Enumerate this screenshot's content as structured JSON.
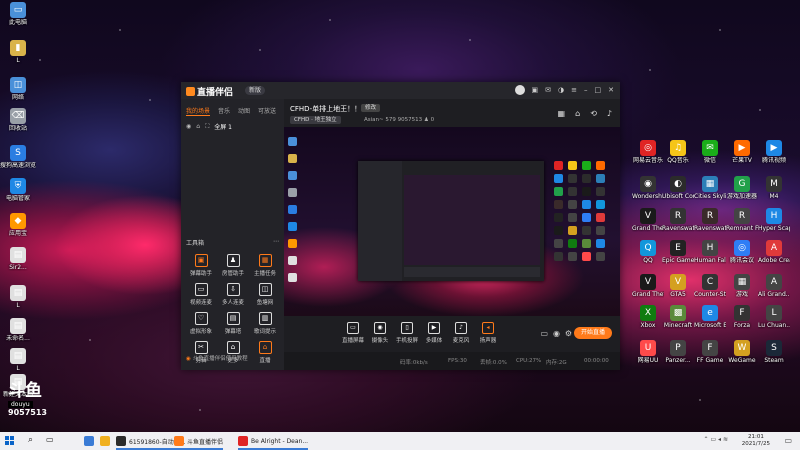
{
  "desktop": {
    "left_icons": [
      {
        "label": "此电脑",
        "color": "#4a90d9",
        "glyph": "▭"
      },
      {
        "label": "L",
        "color": "#d9b34a",
        "glyph": "▮"
      },
      {
        "label": "网络",
        "color": "#4a90d9",
        "glyph": "◫"
      },
      {
        "label": "回收站",
        "color": "#9aa0a8",
        "glyph": "⌫"
      },
      {
        "label": "搜狗高速浏览器",
        "color": "#2a7de1",
        "glyph": "S"
      },
      {
        "label": "电脑管家",
        "color": "#1e88e5",
        "glyph": "⛨"
      },
      {
        "label": "应用宝",
        "color": "#ff9800",
        "glyph": "◆"
      },
      {
        "label": "Sir2...",
        "color": "#e0e0e0",
        "glyph": "▤"
      },
      {
        "label": "L",
        "color": "#e0e0e0",
        "glyph": "▤"
      },
      {
        "label": "未命名...",
        "color": "#e0e0e0",
        "glyph": "▤"
      },
      {
        "label": "L",
        "color": "#e0e0e0",
        "glyph": "▤"
      },
      {
        "label": "新建文本档",
        "color": "#e0e0e0",
        "glyph": "▤"
      }
    ],
    "right_icons": [
      {
        "label": "网易云音乐",
        "color": "#e02424",
        "glyph": "◎"
      },
      {
        "label": "QQ音乐",
        "color": "#f5c518",
        "glyph": "♫"
      },
      {
        "label": "微信",
        "color": "#1aad19",
        "glyph": "✉"
      },
      {
        "label": "芒果TV",
        "color": "#ff6a00",
        "glyph": "▶"
      },
      {
        "label": "腾讯视频",
        "color": "#1e88e5",
        "glyph": "▶"
      },
      {
        "label": "Wondersh... Filmora",
        "color": "#333",
        "glyph": "◉"
      },
      {
        "label": "Ubisoft Connect",
        "color": "#2b2b2b",
        "glyph": "◐"
      },
      {
        "label": "Cities Skylines",
        "color": "#2c7fb8",
        "glyph": "▦"
      },
      {
        "label": "游戏加速器",
        "color": "#21a04a",
        "glyph": "G"
      },
      {
        "label": "M4",
        "color": "#333",
        "glyph": "M"
      },
      {
        "label": "Grand Theft Auto V",
        "color": "#1a1a1a",
        "glyph": "V"
      },
      {
        "label": "Ravenswatch Playtest",
        "color": "#333",
        "glyph": "R"
      },
      {
        "label": "Ravenswatch",
        "color": "#3a2a2a",
        "glyph": "R"
      },
      {
        "label": "Remnant From the...",
        "color": "#444",
        "glyph": "R"
      },
      {
        "label": "Hyper Scape",
        "color": "#1e88e5",
        "glyph": "H"
      },
      {
        "label": "QQ",
        "color": "#1296db",
        "glyph": "Q"
      },
      {
        "label": "Epic Games Launcher",
        "color": "#222",
        "glyph": "E"
      },
      {
        "label": "Human Fall Flat",
        "color": "#444",
        "glyph": "H"
      },
      {
        "label": "腾讯会议",
        "color": "#2e7df6",
        "glyph": "◎"
      },
      {
        "label": "Adobe Creative...",
        "color": "#e03a3a",
        "glyph": "A"
      },
      {
        "label": "Grand Theft Auto V",
        "color": "#1a1a1a",
        "glyph": "V"
      },
      {
        "label": "GTA5",
        "color": "#d4a020",
        "glyph": "V"
      },
      {
        "label": "Counter-Strike",
        "color": "#333",
        "glyph": "C"
      },
      {
        "label": "游戏",
        "color": "#444",
        "glyph": "▦"
      },
      {
        "label": "Ali Grand...",
        "color": "#444",
        "glyph": "A"
      },
      {
        "label": "Xbox",
        "color": "#107c10",
        "glyph": "X"
      },
      {
        "label": "Minecraft",
        "color": "#5a8a3a",
        "glyph": "▩"
      },
      {
        "label": "Microsoft Edge",
        "color": "#1e88e5",
        "glyph": "e"
      },
      {
        "label": "Forza",
        "color": "#333",
        "glyph": "F"
      },
      {
        "label": "Lu Chuan...",
        "color": "#444",
        "glyph": "L"
      },
      {
        "label": "网易UU",
        "color": "#ff4a4a",
        "glyph": "U"
      },
      {
        "label": "Panzer...",
        "color": "#444",
        "glyph": "P"
      },
      {
        "label": "FF Game",
        "color": "#444",
        "glyph": "F"
      },
      {
        "label": "WeGame",
        "color": "#d4a020",
        "glyph": "W"
      },
      {
        "label": "Steam",
        "color": "#1b2838",
        "glyph": "S"
      }
    ],
    "watermark": {
      "brand": "斗鱼",
      "sub": "douyu",
      "room": "9057513"
    }
  },
  "app": {
    "title": "直播伴侣",
    "version_pill": "新版",
    "titlebar_icons": [
      "avatar",
      "message-icon",
      "mail-icon",
      "skin-icon",
      "settings-icon",
      "minimize-icon",
      "maximize-icon",
      "close-icon"
    ],
    "sidebar": {
      "tabs": [
        "我的场景",
        "音乐",
        "动图",
        "可放送"
      ],
      "scene_label": "全屏 1",
      "tools_title": "工具箱",
      "tools": [
        {
          "label": "弹幕助手",
          "glyph": "▣",
          "orange": true
        },
        {
          "label": "房管助手",
          "glyph": "♟",
          "orange": false
        },
        {
          "label": "主播任务",
          "glyph": "▦",
          "orange": true
        },
        {
          "label": "视频连麦",
          "glyph": "▭",
          "orange": false
        },
        {
          "label": "多人连麦",
          "glyph": "⇩",
          "orange": false
        },
        {
          "label": "鱼塘网",
          "glyph": "◫",
          "orange": false
        },
        {
          "label": "虚拟形象",
          "glyph": "♡",
          "orange": false
        },
        {
          "label": "弹幕塔",
          "glyph": "▤",
          "orange": false
        },
        {
          "label": "歌词提示",
          "glyph": "▥",
          "orange": false
        },
        {
          "label": "剪辑",
          "glyph": "✂",
          "orange": false
        },
        {
          "label": "更多",
          "glyph": "⌂",
          "orange": false
        },
        {
          "label": "直播",
          "glyph": "⌂",
          "orange": true
        }
      ],
      "footer": "斗鱼直播伴侣使用教程"
    },
    "stream": {
      "title": "CFHD-单排上地王！！",
      "title_btn": "修改",
      "category": "CFHD · 地王独立",
      "meta": "Asian~ 579  9057513",
      "count": "0"
    },
    "controls": [
      {
        "label": "直播屏幕",
        "glyph": "▭"
      },
      {
        "label": "摄像头",
        "glyph": "◉"
      },
      {
        "label": "手机投屏",
        "glyph": "▯"
      },
      {
        "label": "多媒体",
        "glyph": "▶"
      },
      {
        "label": "麦克风",
        "glyph": "♪"
      },
      {
        "label": "扬声器",
        "glyph": "◂"
      }
    ],
    "go_live": "开始直播",
    "status": {
      "bitrate": "码率:0kb/s",
      "fps": "FPS:30",
      "drop": "丢帧:0.0%",
      "cpu": "CPU:27%",
      "mem": "内存:2G",
      "time": "00:00:00"
    }
  },
  "taskbar": {
    "items": [
      {
        "label": "",
        "color": "#3a7bd5"
      },
      {
        "label": "",
        "color": "#f0b020"
      },
      {
        "label": "61591860-自动备...",
        "color": "#2b2b2b"
      },
      {
        "label": "斗鱼直播伴侣",
        "color": "#ff7a1a"
      },
      {
        "label": "Be Alright - Dean...",
        "color": "#e02424"
      }
    ],
    "time": "21:01",
    "date": "2021/7/25"
  }
}
